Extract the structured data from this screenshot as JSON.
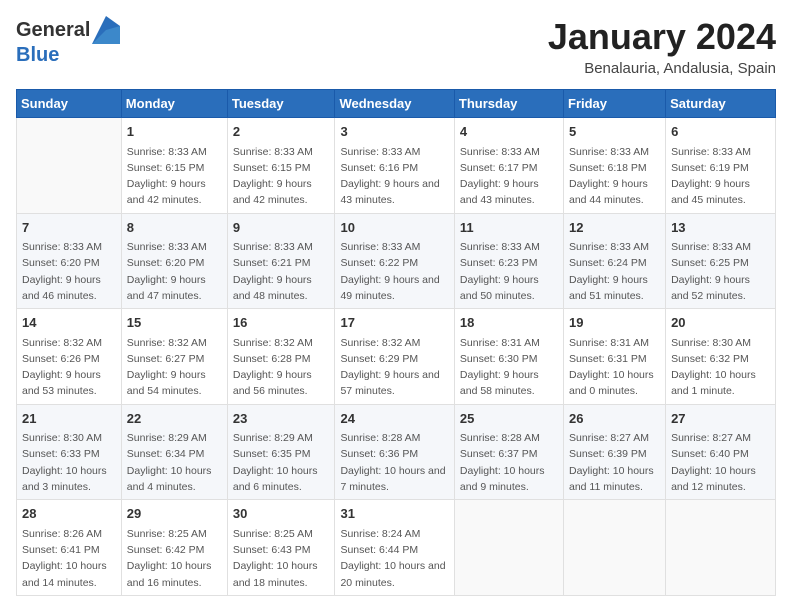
{
  "header": {
    "logo_general": "General",
    "logo_blue": "Blue",
    "title": "January 2024",
    "subtitle": "Benalauria, Andalusia, Spain"
  },
  "calendar": {
    "columns": [
      "Sunday",
      "Monday",
      "Tuesday",
      "Wednesday",
      "Thursday",
      "Friday",
      "Saturday"
    ],
    "rows": [
      [
        {
          "day": "",
          "sunrise": "",
          "sunset": "",
          "daylight": ""
        },
        {
          "day": "1",
          "sunrise": "Sunrise: 8:33 AM",
          "sunset": "Sunset: 6:15 PM",
          "daylight": "Daylight: 9 hours and 42 minutes."
        },
        {
          "day": "2",
          "sunrise": "Sunrise: 8:33 AM",
          "sunset": "Sunset: 6:15 PM",
          "daylight": "Daylight: 9 hours and 42 minutes."
        },
        {
          "day": "3",
          "sunrise": "Sunrise: 8:33 AM",
          "sunset": "Sunset: 6:16 PM",
          "daylight": "Daylight: 9 hours and 43 minutes."
        },
        {
          "day": "4",
          "sunrise": "Sunrise: 8:33 AM",
          "sunset": "Sunset: 6:17 PM",
          "daylight": "Daylight: 9 hours and 43 minutes."
        },
        {
          "day": "5",
          "sunrise": "Sunrise: 8:33 AM",
          "sunset": "Sunset: 6:18 PM",
          "daylight": "Daylight: 9 hours and 44 minutes."
        },
        {
          "day": "6",
          "sunrise": "Sunrise: 8:33 AM",
          "sunset": "Sunset: 6:19 PM",
          "daylight": "Daylight: 9 hours and 45 minutes."
        }
      ],
      [
        {
          "day": "7",
          "sunrise": "Sunrise: 8:33 AM",
          "sunset": "Sunset: 6:20 PM",
          "daylight": "Daylight: 9 hours and 46 minutes."
        },
        {
          "day": "8",
          "sunrise": "Sunrise: 8:33 AM",
          "sunset": "Sunset: 6:20 PM",
          "daylight": "Daylight: 9 hours and 47 minutes."
        },
        {
          "day": "9",
          "sunrise": "Sunrise: 8:33 AM",
          "sunset": "Sunset: 6:21 PM",
          "daylight": "Daylight: 9 hours and 48 minutes."
        },
        {
          "day": "10",
          "sunrise": "Sunrise: 8:33 AM",
          "sunset": "Sunset: 6:22 PM",
          "daylight": "Daylight: 9 hours and 49 minutes."
        },
        {
          "day": "11",
          "sunrise": "Sunrise: 8:33 AM",
          "sunset": "Sunset: 6:23 PM",
          "daylight": "Daylight: 9 hours and 50 minutes."
        },
        {
          "day": "12",
          "sunrise": "Sunrise: 8:33 AM",
          "sunset": "Sunset: 6:24 PM",
          "daylight": "Daylight: 9 hours and 51 minutes."
        },
        {
          "day": "13",
          "sunrise": "Sunrise: 8:33 AM",
          "sunset": "Sunset: 6:25 PM",
          "daylight": "Daylight: 9 hours and 52 minutes."
        }
      ],
      [
        {
          "day": "14",
          "sunrise": "Sunrise: 8:32 AM",
          "sunset": "Sunset: 6:26 PM",
          "daylight": "Daylight: 9 hours and 53 minutes."
        },
        {
          "day": "15",
          "sunrise": "Sunrise: 8:32 AM",
          "sunset": "Sunset: 6:27 PM",
          "daylight": "Daylight: 9 hours and 54 minutes."
        },
        {
          "day": "16",
          "sunrise": "Sunrise: 8:32 AM",
          "sunset": "Sunset: 6:28 PM",
          "daylight": "Daylight: 9 hours and 56 minutes."
        },
        {
          "day": "17",
          "sunrise": "Sunrise: 8:32 AM",
          "sunset": "Sunset: 6:29 PM",
          "daylight": "Daylight: 9 hours and 57 minutes."
        },
        {
          "day": "18",
          "sunrise": "Sunrise: 8:31 AM",
          "sunset": "Sunset: 6:30 PM",
          "daylight": "Daylight: 9 hours and 58 minutes."
        },
        {
          "day": "19",
          "sunrise": "Sunrise: 8:31 AM",
          "sunset": "Sunset: 6:31 PM",
          "daylight": "Daylight: 10 hours and 0 minutes."
        },
        {
          "day": "20",
          "sunrise": "Sunrise: 8:30 AM",
          "sunset": "Sunset: 6:32 PM",
          "daylight": "Daylight: 10 hours and 1 minute."
        }
      ],
      [
        {
          "day": "21",
          "sunrise": "Sunrise: 8:30 AM",
          "sunset": "Sunset: 6:33 PM",
          "daylight": "Daylight: 10 hours and 3 minutes."
        },
        {
          "day": "22",
          "sunrise": "Sunrise: 8:29 AM",
          "sunset": "Sunset: 6:34 PM",
          "daylight": "Daylight: 10 hours and 4 minutes."
        },
        {
          "day": "23",
          "sunrise": "Sunrise: 8:29 AM",
          "sunset": "Sunset: 6:35 PM",
          "daylight": "Daylight: 10 hours and 6 minutes."
        },
        {
          "day": "24",
          "sunrise": "Sunrise: 8:28 AM",
          "sunset": "Sunset: 6:36 PM",
          "daylight": "Daylight: 10 hours and 7 minutes."
        },
        {
          "day": "25",
          "sunrise": "Sunrise: 8:28 AM",
          "sunset": "Sunset: 6:37 PM",
          "daylight": "Daylight: 10 hours and 9 minutes."
        },
        {
          "day": "26",
          "sunrise": "Sunrise: 8:27 AM",
          "sunset": "Sunset: 6:39 PM",
          "daylight": "Daylight: 10 hours and 11 minutes."
        },
        {
          "day": "27",
          "sunrise": "Sunrise: 8:27 AM",
          "sunset": "Sunset: 6:40 PM",
          "daylight": "Daylight: 10 hours and 12 minutes."
        }
      ],
      [
        {
          "day": "28",
          "sunrise": "Sunrise: 8:26 AM",
          "sunset": "Sunset: 6:41 PM",
          "daylight": "Daylight: 10 hours and 14 minutes."
        },
        {
          "day": "29",
          "sunrise": "Sunrise: 8:25 AM",
          "sunset": "Sunset: 6:42 PM",
          "daylight": "Daylight: 10 hours and 16 minutes."
        },
        {
          "day": "30",
          "sunrise": "Sunrise: 8:25 AM",
          "sunset": "Sunset: 6:43 PM",
          "daylight": "Daylight: 10 hours and 18 minutes."
        },
        {
          "day": "31",
          "sunrise": "Sunrise: 8:24 AM",
          "sunset": "Sunset: 6:44 PM",
          "daylight": "Daylight: 10 hours and 20 minutes."
        },
        {
          "day": "",
          "sunrise": "",
          "sunset": "",
          "daylight": ""
        },
        {
          "day": "",
          "sunrise": "",
          "sunset": "",
          "daylight": ""
        },
        {
          "day": "",
          "sunrise": "",
          "sunset": "",
          "daylight": ""
        }
      ]
    ]
  }
}
